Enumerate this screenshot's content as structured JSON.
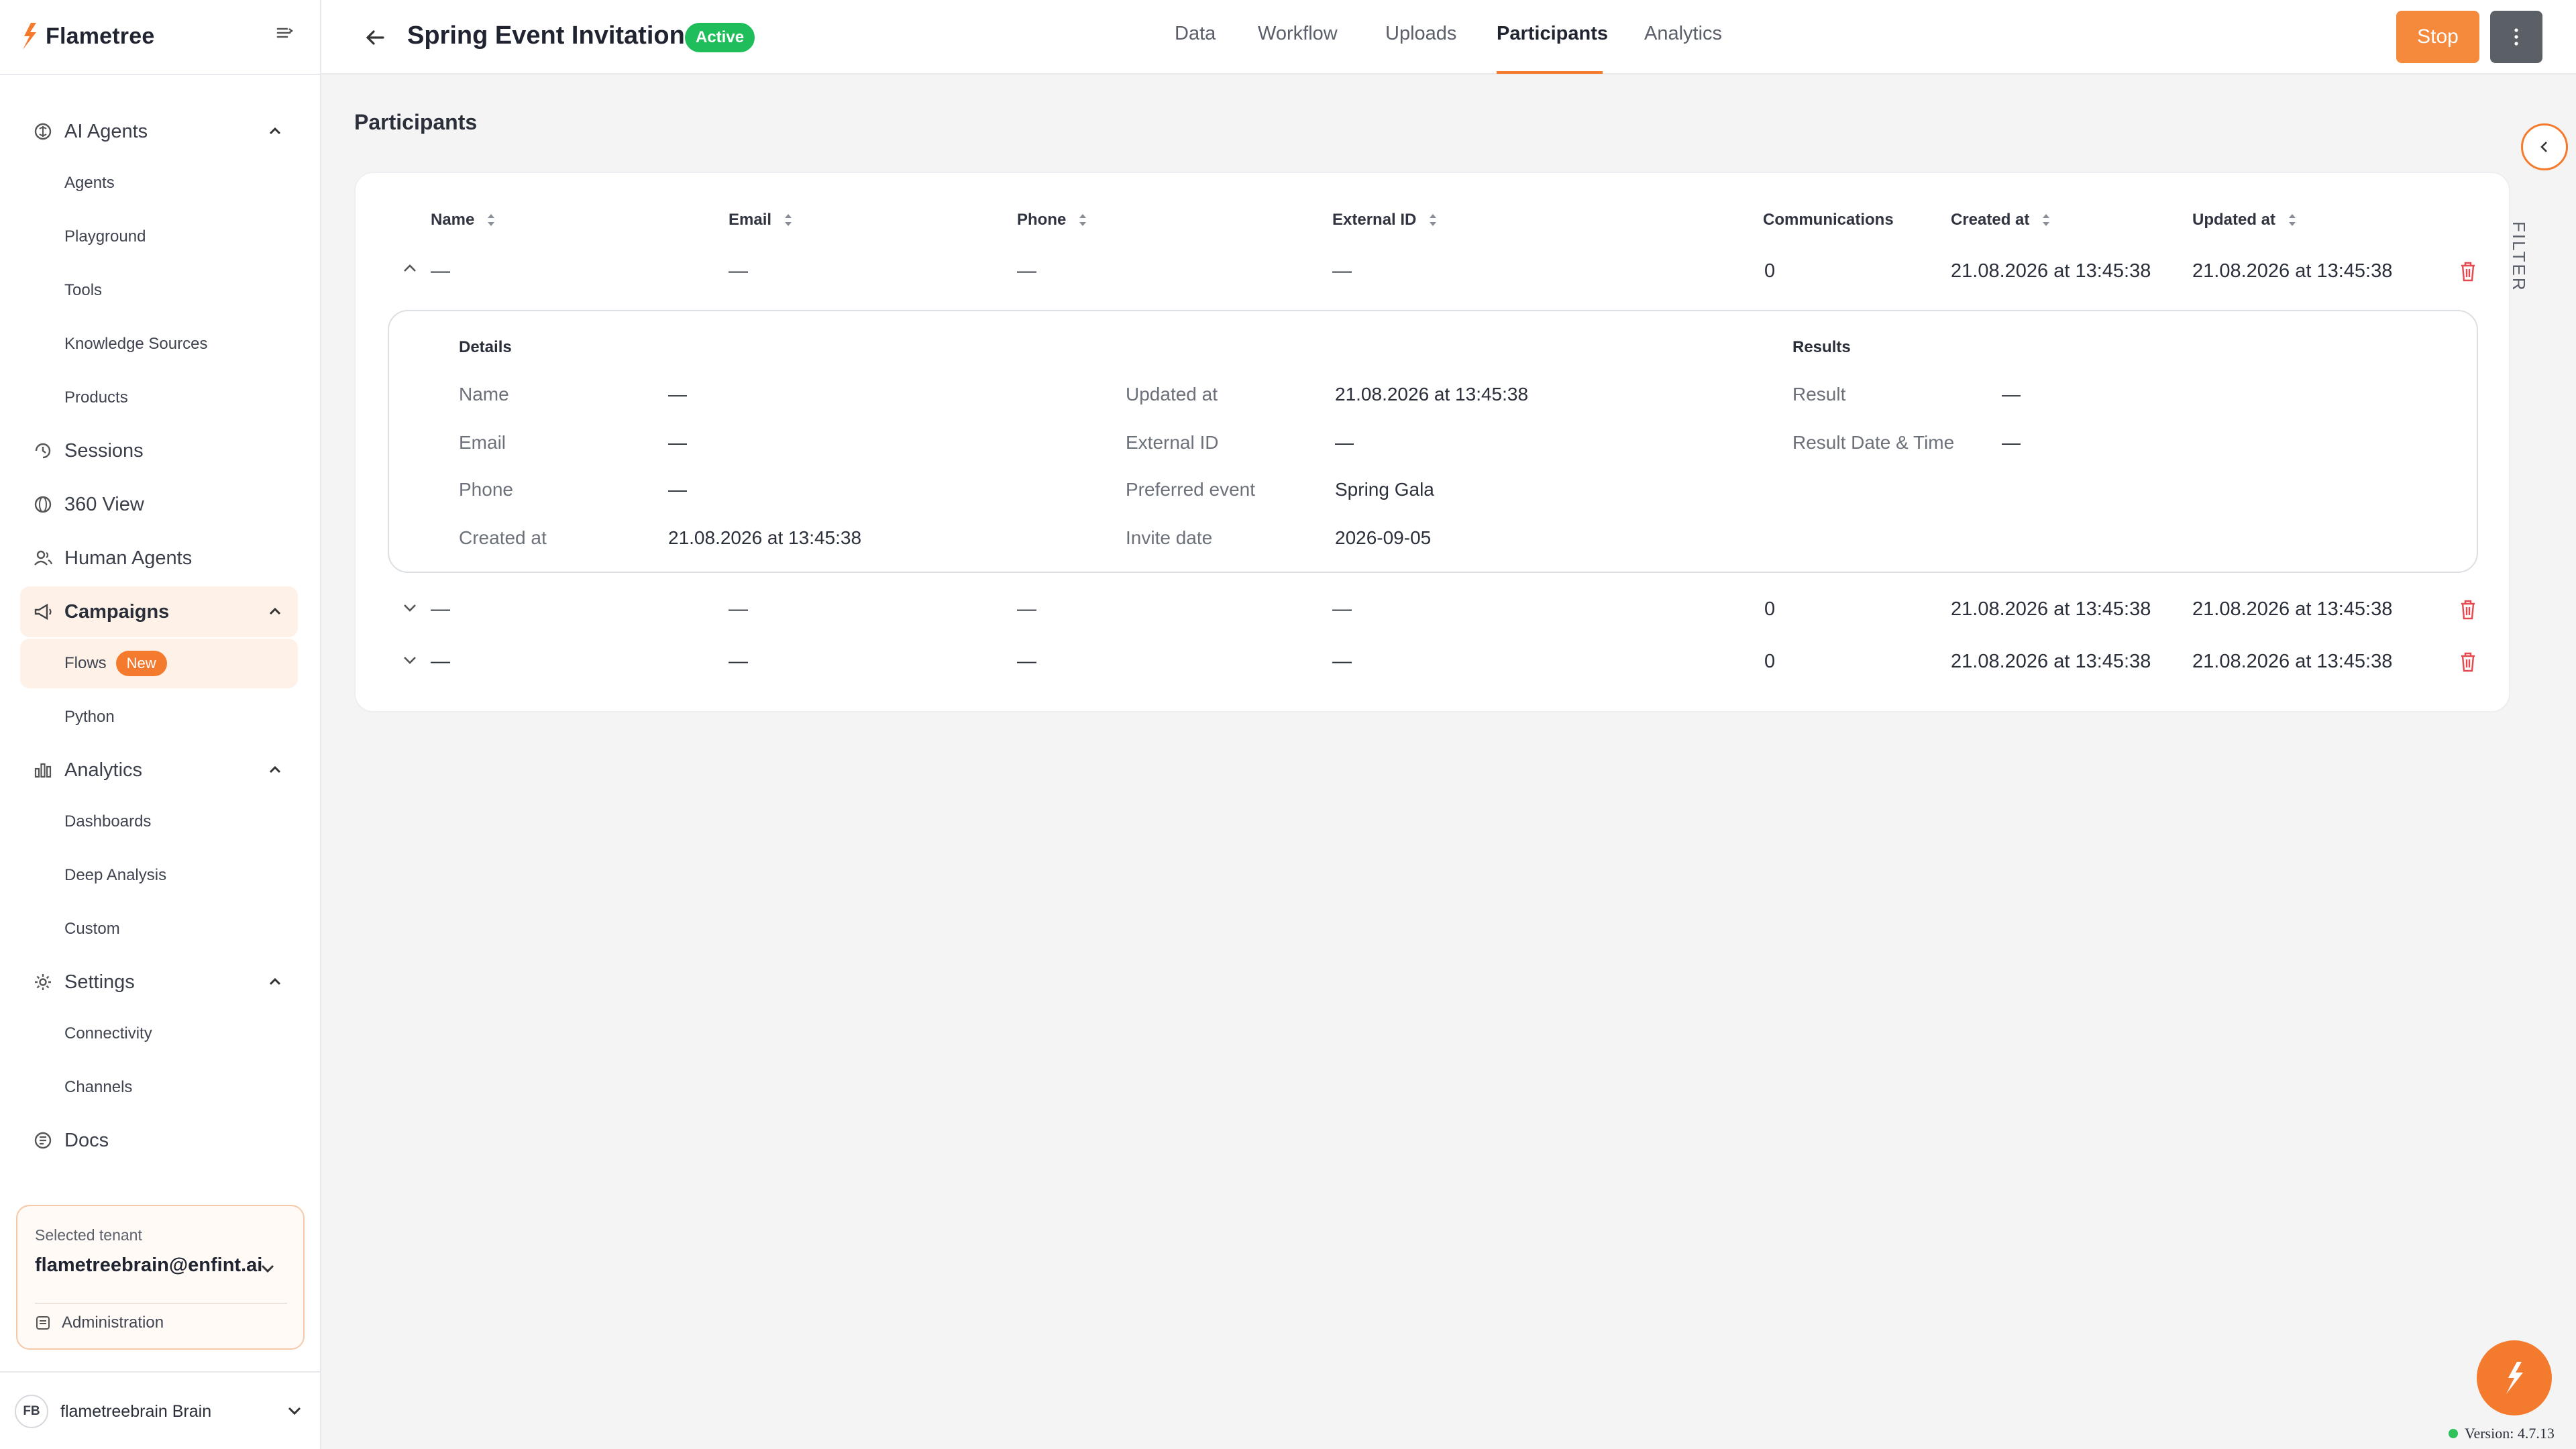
{
  "app": {
    "name": "Flametree",
    "brand_color": "#f47a2e"
  },
  "sidebar": {
    "items": [
      {
        "label": "AI Agents",
        "icon": "brain-icon",
        "expandable": true
      },
      {
        "label": "Agents"
      },
      {
        "label": "Playground"
      },
      {
        "label": "Tools"
      },
      {
        "label": "Knowledge Sources"
      },
      {
        "label": "Products"
      },
      {
        "label": "Sessions",
        "icon": "sessions-icon"
      },
      {
        "label": "360 View",
        "icon": "globe-icon"
      },
      {
        "label": "Human Agents",
        "icon": "users-icon"
      },
      {
        "label": "Campaigns",
        "icon": "megaphone-icon",
        "expandable": true,
        "active": true
      },
      {
        "label": "Flows",
        "badge": "New",
        "active": true
      },
      {
        "label": "Python"
      },
      {
        "label": "Analytics",
        "icon": "bar-chart-icon",
        "expandable": true
      },
      {
        "label": "Dashboards"
      },
      {
        "label": "Deep Analysis"
      },
      {
        "label": "Custom"
      },
      {
        "label": "Settings",
        "icon": "gear-icon",
        "expandable": true
      },
      {
        "label": "Connectivity"
      },
      {
        "label": "Channels"
      },
      {
        "label": "Docs",
        "icon": "docs-icon"
      }
    ],
    "tenant": {
      "label": "Selected tenant",
      "value": "flametreebrain@enfint.ai",
      "admin_label": "Administration"
    },
    "user": {
      "initials": "FB",
      "name": "flametreebrain Brain"
    }
  },
  "header": {
    "title": "Spring Event Invitations",
    "status": "Active",
    "tabs": [
      "Data",
      "Workflow",
      "Uploads",
      "Participants",
      "Analytics"
    ],
    "active_tab": "Participants",
    "stop_label": "Stop"
  },
  "main": {
    "section_title": "Participants",
    "columns": [
      "Name",
      "Email",
      "Phone",
      "External ID",
      "Communications",
      "Created at",
      "Updated at"
    ],
    "rows": [
      {
        "name": "—",
        "email": "—",
        "phone": "—",
        "external_id": "—",
        "communications": "0",
        "created_at": "21.08.2026 at 13:45:38",
        "updated_at": "21.08.2026 at 13:45:38",
        "expanded": true
      },
      {
        "name": "—",
        "email": "—",
        "phone": "—",
        "external_id": "—",
        "communications": "0",
        "created_at": "21.08.2026 at 13:45:38",
        "updated_at": "21.08.2026 at 13:45:38",
        "expanded": false
      },
      {
        "name": "—",
        "email": "—",
        "phone": "—",
        "external_id": "—",
        "communications": "0",
        "created_at": "21.08.2026 at 13:45:38",
        "updated_at": "21.08.2026 at 13:45:38",
        "expanded": false
      }
    ],
    "details": {
      "details_heading": "Details",
      "results_heading": "Results",
      "col1": [
        {
          "label": "Name",
          "value": "—"
        },
        {
          "label": "Email",
          "value": "—"
        },
        {
          "label": "Phone",
          "value": "—"
        },
        {
          "label": "Created at",
          "value": "21.08.2026 at 13:45:38"
        }
      ],
      "col2": [
        {
          "label": "Updated at",
          "value": "21.08.2026 at 13:45:38"
        },
        {
          "label": "External ID",
          "value": "—"
        },
        {
          "label": "Preferred event",
          "value": "Spring Gala"
        },
        {
          "label": "Invite date",
          "value": "2026-09-05"
        }
      ],
      "results": [
        {
          "label": "Result",
          "value": "—"
        },
        {
          "label": "Result Date & Time",
          "value": "—"
        }
      ]
    }
  },
  "filter_label": "FILTER",
  "version": "Version: 4.7.13"
}
